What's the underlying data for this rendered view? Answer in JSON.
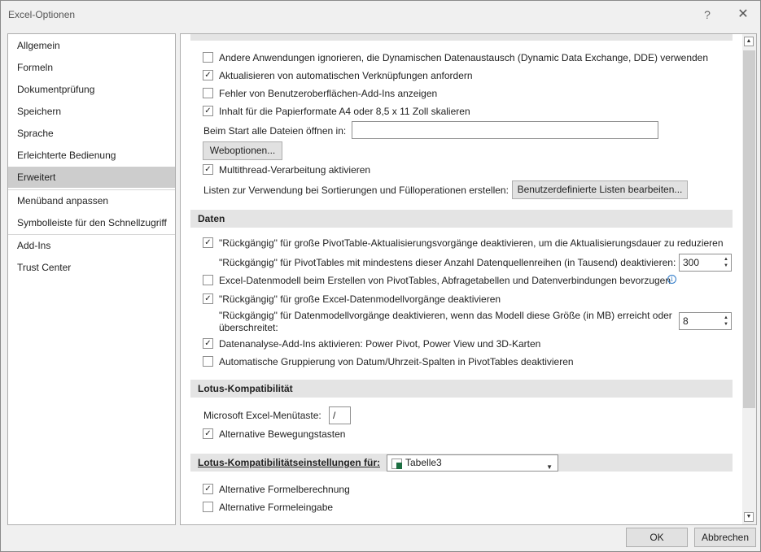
{
  "window": {
    "title": "Excel-Optionen",
    "help": "?",
    "close": "✕"
  },
  "nav": {
    "items": [
      {
        "label": "Allgemein"
      },
      {
        "label": "Formeln"
      },
      {
        "label": "Dokumentprüfung"
      },
      {
        "label": "Speichern"
      },
      {
        "label": "Sprache"
      },
      {
        "label": "Erleichterte Bedienung"
      },
      {
        "label": "Erweitert",
        "selected": true
      },
      {
        "label": "Menüband anpassen"
      },
      {
        "label": "Symbolleiste für den Schnellzugriff"
      },
      {
        "label": "Add-Ins"
      },
      {
        "label": "Trust Center"
      }
    ]
  },
  "general": {
    "opt1": {
      "label": "Andere Anwendungen ignorieren, die Dynamischen Datenaustausch (Dynamic Data Exchange, DDE) verwenden",
      "checked": false
    },
    "opt2": {
      "label": "Aktualisieren von automatischen Verknüpfungen anfordern",
      "checked": true
    },
    "opt3": {
      "label": "Fehler von Benutzeroberflächen-Add-Ins anzeigen",
      "checked": false
    },
    "opt4": {
      "label": "Inhalt für die Papierformate A4 oder 8,5 x 11 Zoll skalieren",
      "checked": true
    },
    "startup_label": "Beim Start alle Dateien öffnen in:",
    "startup_value": "",
    "weboptions_button": "Weboptionen...",
    "opt5": {
      "label": "Multithread-Verarbeitung aktivieren",
      "checked": true
    },
    "lists_label": "Listen zur Verwendung bei Sortierungen und Fülloperationen erstellen:",
    "lists_button": "Benutzerdefinierte Listen bearbeiten..."
  },
  "data": {
    "header": "Daten",
    "opt1": {
      "label": "\"Rückgängig\" für große PivotTable-Aktualisierungsvorgänge deaktivieren, um die Aktualisierungsdauer zu reduzieren",
      "checked": true
    },
    "pivot_rows_label": "\"Rückgängig\" für PivotTables mit mindestens dieser Anzahl Datenquellenreihen (in Tausend) deaktivieren:",
    "pivot_rows_value": "300",
    "opt2": {
      "label": "Excel-Datenmodell beim Erstellen von PivotTables, Abfragetabellen und Datenverbindungen bevorzugen",
      "checked": false
    },
    "info_icon": "i",
    "opt3": {
      "label": "\"Rückgängig\" für große Excel-Datenmodellvorgänge deaktivieren",
      "checked": true
    },
    "model_size_label_1": "\"Rückgängig\" für Datenmodellvorgänge deaktivieren, wenn das Modell diese Größe (in MB) erreicht oder",
    "model_size_label_2": "überschreitet:",
    "model_size_value": "8",
    "opt4": {
      "label": "Datenanalyse-Add-Ins aktivieren: Power Pivot, Power View und 3D-Karten",
      "checked": true
    },
    "opt5": {
      "label": "Automatische Gruppierung von Datum/Uhrzeit-Spalten in PivotTables deaktivieren",
      "checked": false
    }
  },
  "lotus": {
    "header": "Lotus-Kompatibilität",
    "menu_key_label": "Microsoft Excel-Menütaste:",
    "menu_key_value": "/",
    "opt1": {
      "label": "Alternative Bewegungstasten",
      "checked": true
    }
  },
  "lotus_settings": {
    "header": "Lotus-Kompatibilitätseinstellungen für:",
    "sheet_value": "Tabelle3",
    "opt1": {
      "label": "Alternative Formelberechnung",
      "checked": true
    },
    "opt2": {
      "label": "Alternative Formeleingabe",
      "checked": false
    }
  },
  "footer": {
    "ok": "OK",
    "cancel": "Abbrechen"
  }
}
